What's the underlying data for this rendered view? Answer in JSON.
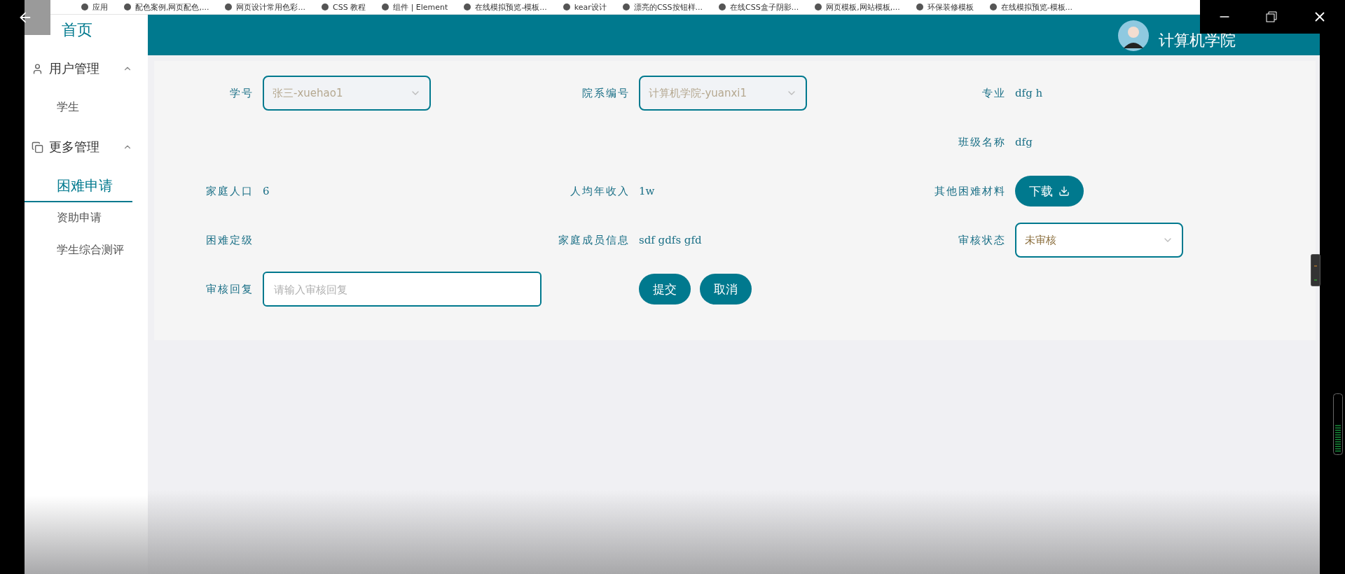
{
  "bookmarks": [
    {
      "label": "应用"
    },
    {
      "label": "配色案例,网页配色,..."
    },
    {
      "label": "网页设计常用色彩..."
    },
    {
      "label": "CSS 教程"
    },
    {
      "label": "组件 | Element"
    },
    {
      "label": "在线模拟预览-模板..."
    },
    {
      "label": "kear设计"
    },
    {
      "label": "漂亮的CSS按钮样..."
    },
    {
      "label": "在线CSS盒子阴影..."
    },
    {
      "label": "网页模板,网站模板,..."
    },
    {
      "label": "环保装修模板"
    },
    {
      "label": "在线模拟预览-模板..."
    }
  ],
  "sidebar": {
    "home": "首页",
    "groups": [
      {
        "label": "用户管理",
        "kind": "user",
        "expanded": true,
        "items": [
          {
            "label": "学生",
            "selected": false
          }
        ]
      },
      {
        "label": "更多管理",
        "kind": "copy",
        "expanded": true,
        "items": [
          {
            "label": "困难申请",
            "selected": true
          },
          {
            "label": "资助申请",
            "selected": false
          },
          {
            "label": "学生综合测评",
            "selected": false
          }
        ]
      }
    ]
  },
  "header": {
    "title": "计算机学院"
  },
  "form": {
    "cells": [
      {
        "kind": "select",
        "label": "学号",
        "value": "张三-xuehao1",
        "disabled": true
      },
      {
        "kind": "select",
        "label": "院系编号",
        "value": "计算机学院-yuanxi1",
        "disabled": true
      },
      {
        "kind": "text",
        "label": "专业",
        "value": "dfg h"
      },
      {
        "kind": "blank"
      },
      {
        "kind": "blank"
      },
      {
        "kind": "text",
        "label": "班级名称",
        "value": "dfg"
      },
      {
        "kind": "text",
        "label": "家庭人口",
        "value": "6"
      },
      {
        "kind": "text",
        "label": "人均年收入",
        "value": "1w"
      },
      {
        "kind": "button",
        "label": "其他困难材料",
        "button": "下载"
      },
      {
        "kind": "text",
        "label": "困难定级"
      },
      {
        "kind": "text",
        "label": "家庭成员信息",
        "value": "sdf gdfs gfd"
      },
      {
        "kind": "select",
        "label": "审核状态",
        "value": "未审核",
        "disabled": false
      },
      {
        "kind": "input",
        "label": "审核回复",
        "placeholder": "请输入审核回复"
      },
      {
        "kind": "actions",
        "buttons": [
          "提交",
          "取消"
        ]
      },
      {
        "kind": "blank"
      }
    ]
  }
}
